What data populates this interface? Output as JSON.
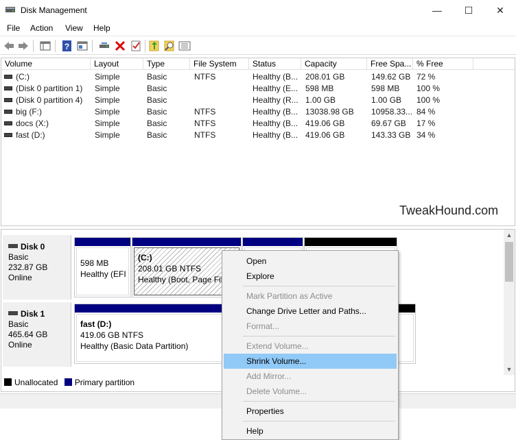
{
  "window": {
    "title": "Disk Management",
    "minimize_glyph": "—",
    "maximize_glyph": "☐",
    "close_glyph": "✕"
  },
  "menu": [
    "File",
    "Action",
    "View",
    "Help"
  ],
  "toolbar_icons": [
    "back-arrow-icon",
    "forward-arrow-icon",
    "console-tree-icon",
    "help-icon",
    "show-hide-icon",
    "connect-drive-icon",
    "delete-icon",
    "properties-icon",
    "refresh-icon",
    "rescan-icon",
    "list-view-icon"
  ],
  "columns": [
    "Volume",
    "Layout",
    "Type",
    "File System",
    "Status",
    "Capacity",
    "Free Spa...",
    "% Free"
  ],
  "volumes": [
    {
      "volume": "(C:)",
      "layout": "Simple",
      "type": "Basic",
      "fs": "NTFS",
      "status": "Healthy (B...",
      "capacity": "208.01 GB",
      "free": "149.62 GB",
      "pct": "72 %"
    },
    {
      "volume": "(Disk 0 partition 1)",
      "layout": "Simple",
      "type": "Basic",
      "fs": "",
      "status": "Healthy (E...",
      "capacity": "598 MB",
      "free": "598 MB",
      "pct": "100 %"
    },
    {
      "volume": "(Disk 0 partition 4)",
      "layout": "Simple",
      "type": "Basic",
      "fs": "",
      "status": "Healthy (R...",
      "capacity": "1.00 GB",
      "free": "1.00 GB",
      "pct": "100 %"
    },
    {
      "volume": "big (F:)",
      "layout": "Simple",
      "type": "Basic",
      "fs": "NTFS",
      "status": "Healthy (B...",
      "capacity": "13038.98 GB",
      "free": "10958.33...",
      "pct": "84 %"
    },
    {
      "volume": "docs (X:)",
      "layout": "Simple",
      "type": "Basic",
      "fs": "NTFS",
      "status": "Healthy (B...",
      "capacity": "419.06 GB",
      "free": "69.67 GB",
      "pct": "17 %"
    },
    {
      "volume": "fast (D:)",
      "layout": "Simple",
      "type": "Basic",
      "fs": "NTFS",
      "status": "Healthy (B...",
      "capacity": "419.06 GB",
      "free": "143.33 GB",
      "pct": "34 %"
    }
  ],
  "watermark": "TweakHound.com",
  "disks": [
    {
      "name": "Disk 0",
      "type": "Basic",
      "size": "232.87 GB",
      "state": "Online",
      "partitions": [
        {
          "name": "",
          "size": "598 MB",
          "status": "Healthy (EFI S"
        },
        {
          "name": "(C:)",
          "size": "208.01 GB NTFS",
          "status": "Healthy (Boot, Page File"
        },
        {
          "name": "",
          "size": "",
          "status": ""
        },
        {
          "name": "",
          "size": "",
          "status": ""
        }
      ]
    },
    {
      "name": "Disk 1",
      "type": "Basic",
      "size": "465.64 GB",
      "state": "Online",
      "partitions": [
        {
          "name": "fast  (D:)",
          "size": "419.06 GB NTFS",
          "status": "Healthy (Basic Data Partition)"
        },
        {
          "name": "",
          "size": "",
          "status": ""
        }
      ]
    }
  ],
  "legend": [
    {
      "label": "Unallocated",
      "color": "#000000"
    },
    {
      "label": "Primary partition",
      "color": "#000080"
    }
  ],
  "context_menu": [
    {
      "label": "Open",
      "enabled": true
    },
    {
      "label": "Explore",
      "enabled": true
    },
    {
      "label": "Mark Partition as Active",
      "enabled": false
    },
    {
      "label": "Change Drive Letter and Paths...",
      "enabled": true
    },
    {
      "label": "Format...",
      "enabled": false
    },
    {
      "label": "Extend Volume...",
      "enabled": false
    },
    {
      "label": "Shrink Volume...",
      "enabled": true,
      "highlighted": true
    },
    {
      "label": "Add Mirror...",
      "enabled": false
    },
    {
      "label": "Delete Volume...",
      "enabled": false
    },
    {
      "label": "Properties",
      "enabled": true
    },
    {
      "label": "Help",
      "enabled": true
    }
  ]
}
